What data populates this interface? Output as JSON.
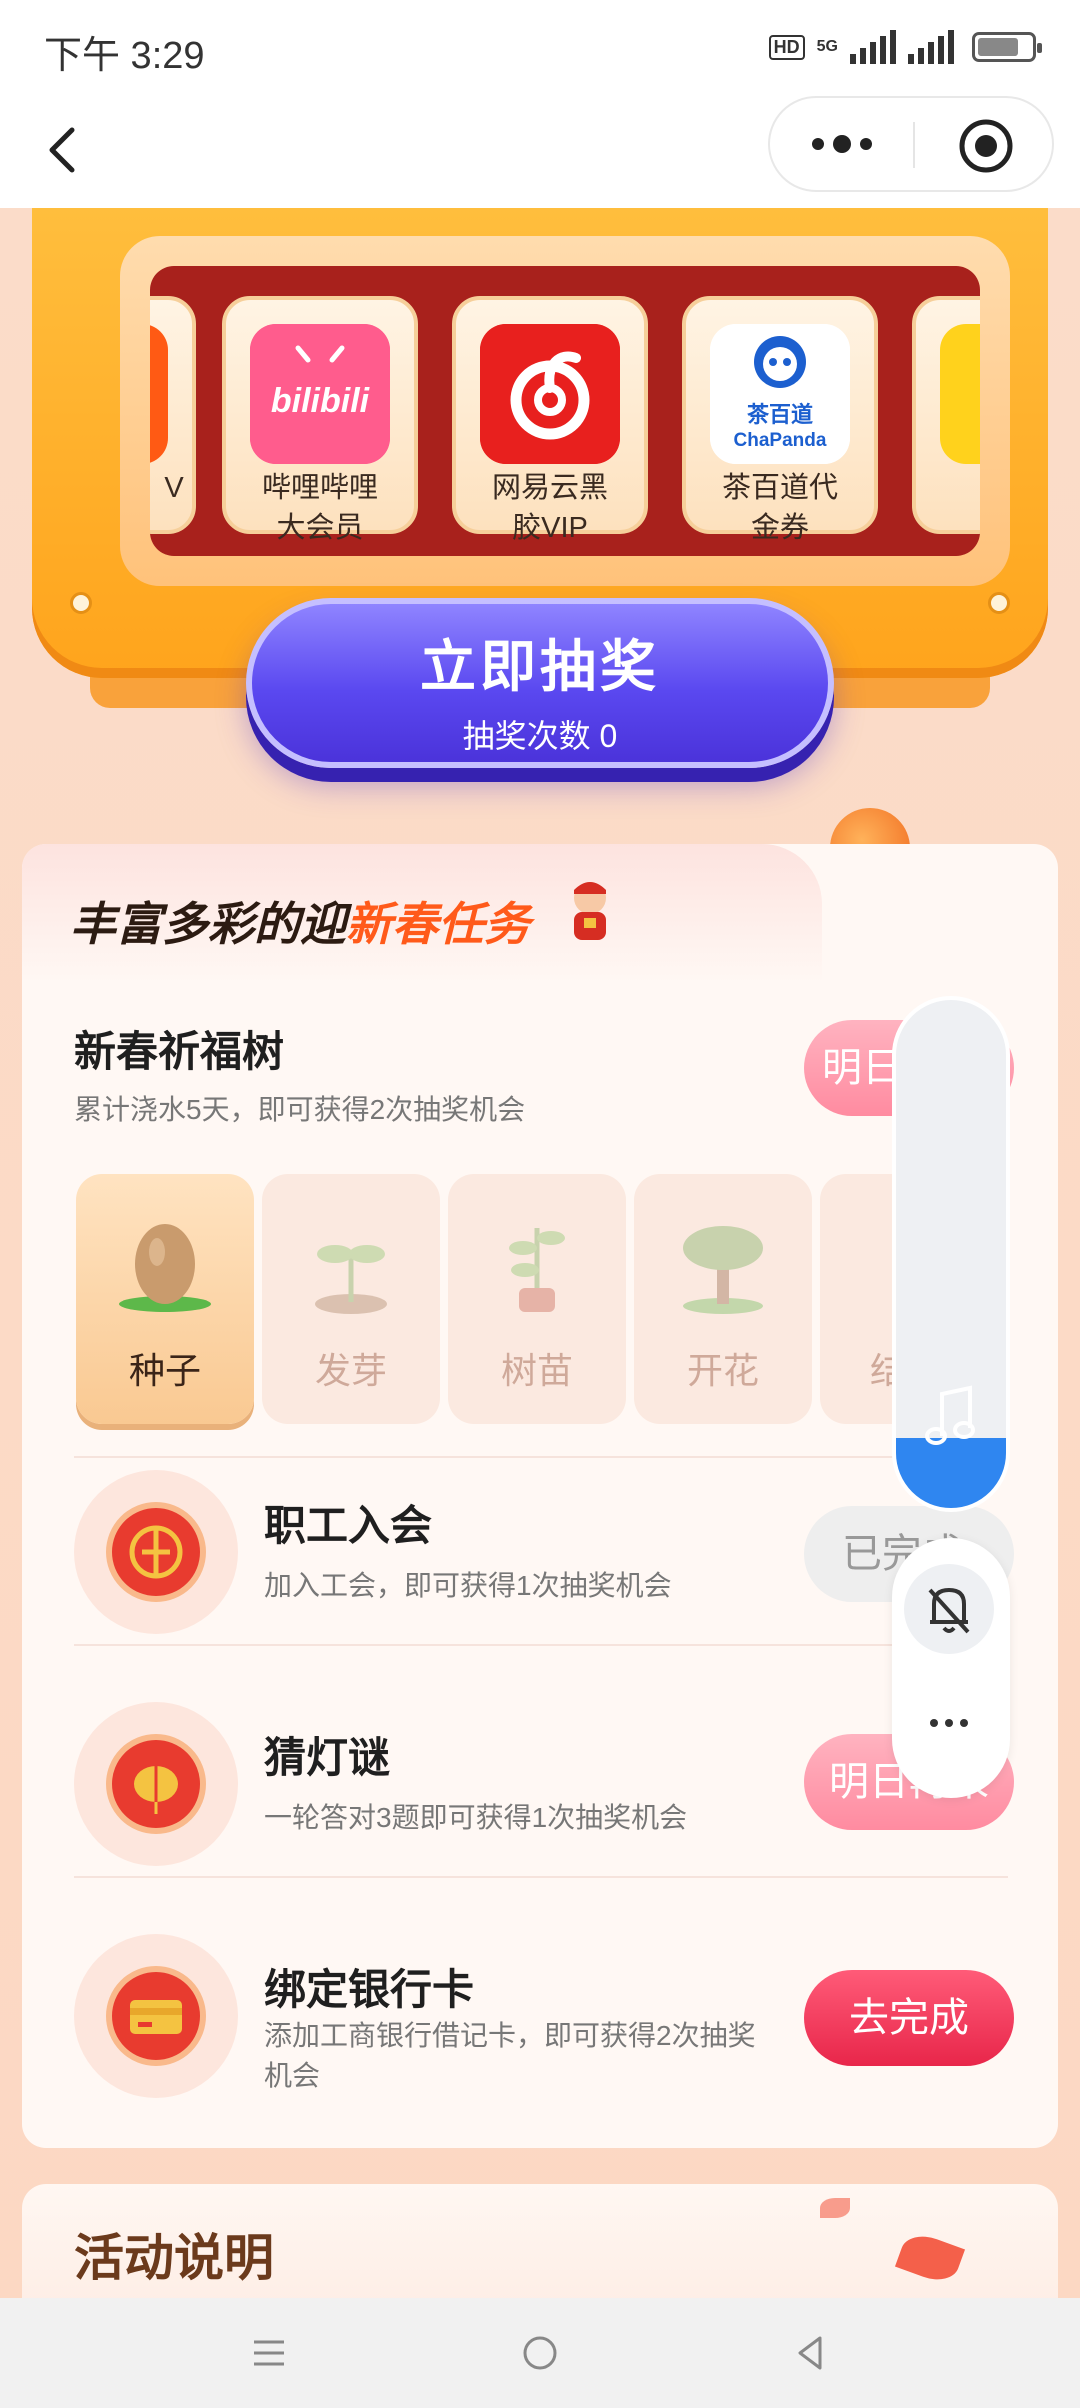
{
  "status_bar": {
    "time": "下午 3:29",
    "hd": "HD",
    "network": "5G"
  },
  "slot_machine": {
    "prizes": [
      {
        "label": "V",
        "color": "#ff5a14"
      },
      {
        "label": "哔哩哔哩大会员",
        "line1": "哔哩哔哩",
        "line2": "大会员",
        "icon_text": "bilibili",
        "color": "#ff5c8d"
      },
      {
        "label": "网易云黑胶VIP",
        "line1": "网易云黑",
        "line2": "胶VIP",
        "color": "#e8201e"
      },
      {
        "label": "茶百道代金券",
        "line1": "茶百道代",
        "line2": "金券",
        "icon_text1": "茶百道",
        "icon_text2": "ChaPanda",
        "color": "#1c5fcf"
      }
    ],
    "draw_button": {
      "label": "立即抽奖",
      "count_label": "抽奖次数 0"
    }
  },
  "tasks_section": {
    "title_prefix": "丰富多彩的迎",
    "title_highlight": "新春任务",
    "tree": {
      "title": "新春祈福树",
      "desc": "累计浇水5天，即可获得2次抽奖机会",
      "button": "明日再来",
      "stages": [
        "种子",
        "发芽",
        "树苗",
        "开花",
        "结"
      ]
    },
    "items": [
      {
        "title": "职工入会",
        "desc": "加入工会，即可获得1次抽奖机会",
        "button": "已完成",
        "state": "done"
      },
      {
        "title": "猜灯谜",
        "desc": "一轮答对3题即可获得1次抽奖机会",
        "button": "明日再来",
        "state": "tomorrow"
      },
      {
        "title": "绑定银行卡",
        "desc": "添加工商银行借记卡，即可获得2次抽奖机会",
        "button": "去完成",
        "state": "go"
      }
    ]
  },
  "explain": {
    "title": "活动说明"
  },
  "float_panel": {
    "music_icon": "music-note-icon",
    "mute_icon": "bell-off-icon",
    "more_icon": "more-dots-icon",
    "volume_fraction": 0.2
  },
  "colors": {
    "accent_purple": "#5a48f0",
    "accent_red": "#e8264a",
    "highlight_orange": "#ff5a1a"
  }
}
